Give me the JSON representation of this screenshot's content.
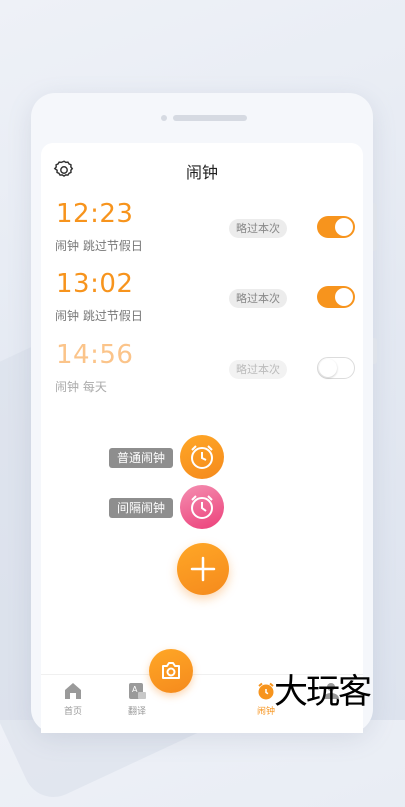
{
  "header": {
    "title": "闹钟"
  },
  "alarms": [
    {
      "time": "12:23",
      "subtitle": "闹钟  跳过节假日",
      "skip_label": "略过本次",
      "enabled": true
    },
    {
      "time": "13:02",
      "subtitle": "闹钟  跳过节假日",
      "skip_label": "略过本次",
      "enabled": true
    },
    {
      "time": "14:56",
      "subtitle": "闹钟  每天",
      "skip_label": "略过本次",
      "enabled": false
    }
  ],
  "fab_menu": {
    "normal_label": "普通闹钟",
    "interval_label": "间隔闹钟"
  },
  "tabbar": {
    "tabs": [
      {
        "label": "首页"
      },
      {
        "label": "翻译"
      },
      {
        "label": "闹钟"
      },
      {
        "label": ""
      }
    ]
  },
  "watermark": "大玩客",
  "colors": {
    "accent": "#f7941d",
    "pink": "#f06292",
    "label_bg": "#8e8e8e"
  }
}
